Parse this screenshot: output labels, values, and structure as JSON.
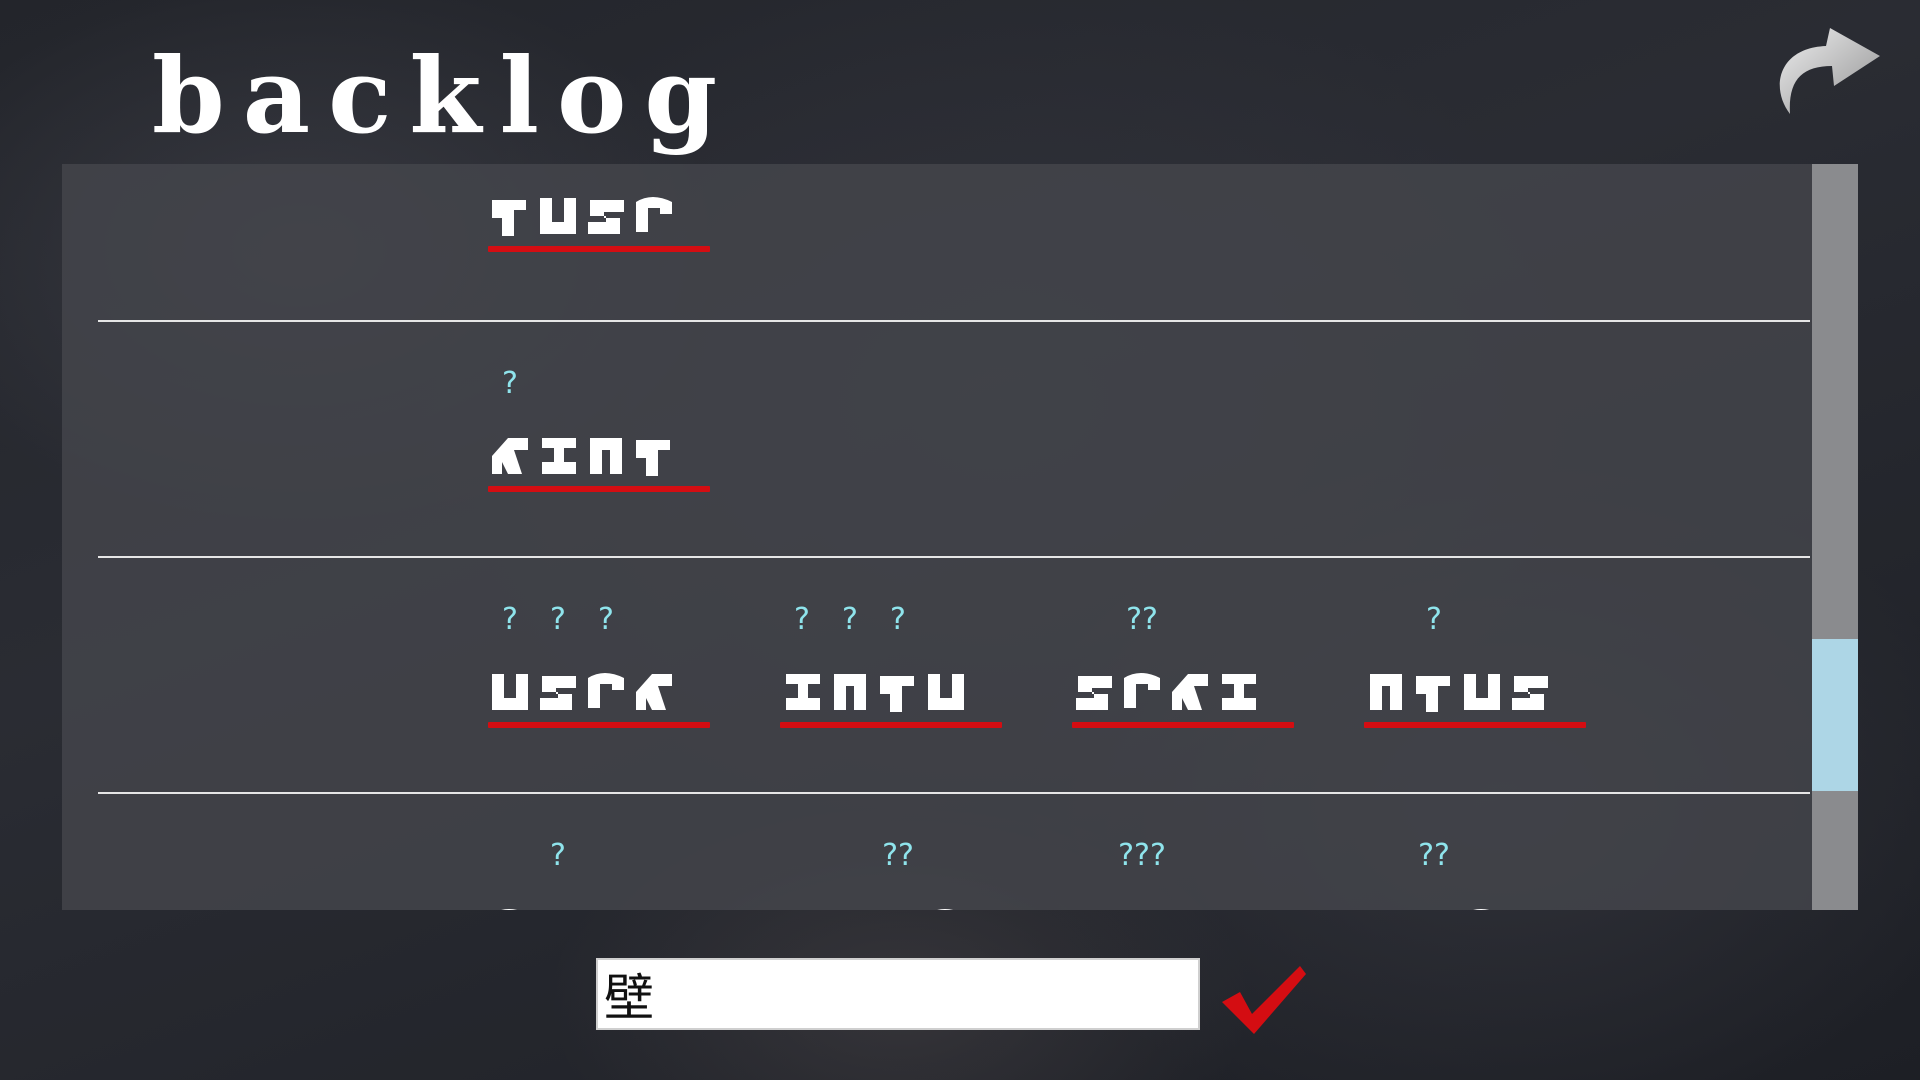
{
  "screen": {
    "title": "backlog",
    "back_icon": "curved-arrow-back-icon"
  },
  "colors": {
    "hint": "#8fe4ec",
    "underline": "#d40d12",
    "scroll_thumb": "#add6e6",
    "confirm": "#d40d12"
  },
  "entries": [
    {
      "words": [
        {
          "glyphs": 4,
          "hints": []
        }
      ]
    },
    {
      "words": [
        {
          "glyphs": 4,
          "hints": [
            "?",
            "",
            "",
            ""
          ]
        }
      ]
    },
    {
      "words": [
        {
          "glyphs": 4,
          "hints": [
            "?",
            "?",
            "?",
            ""
          ]
        },
        {
          "glyphs": 4,
          "hints": [
            "?",
            "?",
            "?",
            ""
          ]
        },
        {
          "glyphs": 4,
          "hints": [
            "",
            "??",
            "",
            ""
          ]
        },
        {
          "glyphs": 4,
          "hints": [
            "",
            "?",
            "",
            ""
          ]
        }
      ]
    },
    {
      "words": [
        {
          "glyphs": 4,
          "hints": [
            "",
            "?",
            "",
            ""
          ]
        },
        {
          "glyphs": 4,
          "hints": [
            "",
            "",
            "??",
            ""
          ]
        },
        {
          "glyphs": 3,
          "hints": [
            "",
            "???",
            ""
          ]
        },
        {
          "glyphs": 4,
          "hints": [
            "",
            "",
            "??",
            ""
          ]
        }
      ]
    }
  ],
  "scroll": {
    "position": 0.8
  },
  "answer": {
    "value": "壁",
    "placeholder": ""
  },
  "confirm_icon": "checkmark-icon"
}
